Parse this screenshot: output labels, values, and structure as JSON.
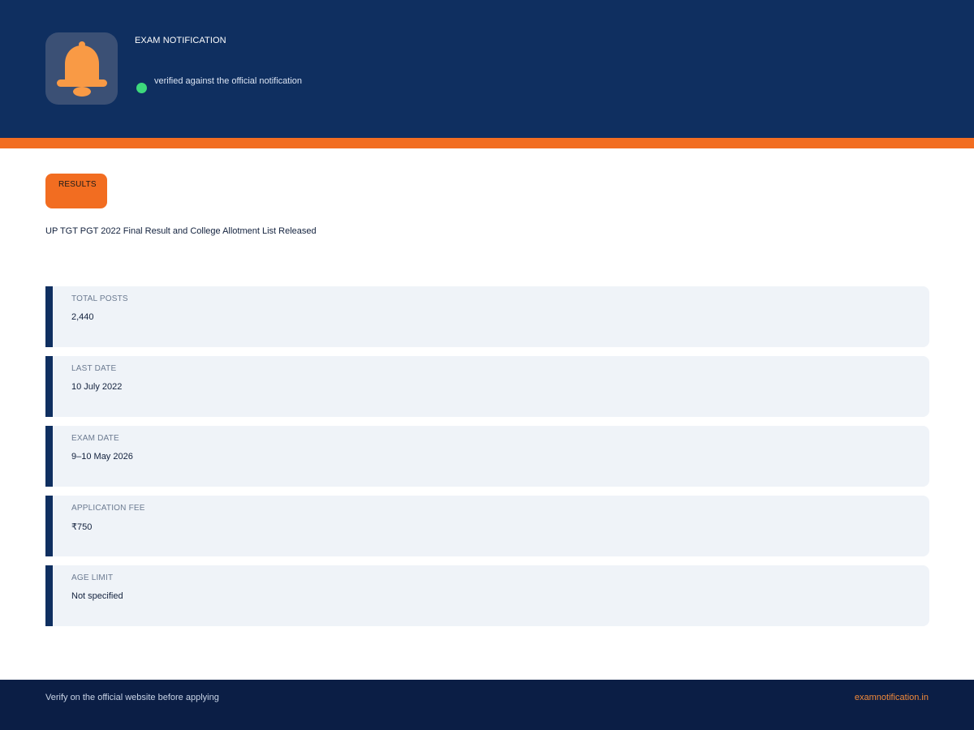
{
  "header": {
    "label": "EXAM NOTIFICATION",
    "status_text": "verified against the official notification",
    "icon": "bell-icon",
    "status_color": "#3dd97c"
  },
  "main": {
    "badge": "RESULTS",
    "title": "UP TGT PGT 2022 Final Result and College Allotment List Released"
  },
  "info_cards": [
    {
      "label": "TOTAL POSTS",
      "value": "2,440"
    },
    {
      "label": "LAST DATE",
      "value": "10 July 2022"
    },
    {
      "label": "EXAM DATE",
      "value": "9–10 May 2026"
    },
    {
      "label": "APPLICATION FEE",
      "value": "₹750"
    },
    {
      "label": "AGE LIMIT",
      "value": "Not specified"
    }
  ],
  "footer": {
    "note": "Verify on the official website before applying",
    "link": "examnotification.in"
  },
  "colors": {
    "brand_navy": "#0f2f60",
    "accent_orange": "#f26d21",
    "card_bg": "#eff3f8",
    "footer_bg": "#0b1e45"
  }
}
